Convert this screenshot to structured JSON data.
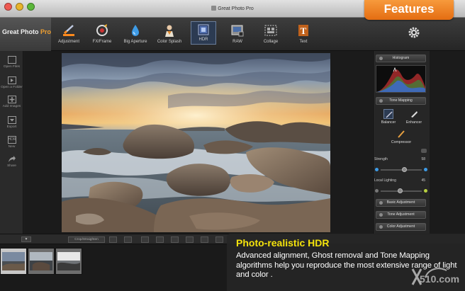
{
  "window": {
    "title": "Great Photo Pro"
  },
  "features_tab": "Features",
  "brand": {
    "name": "Great Photo",
    "suffix": "Pro"
  },
  "toolbar": {
    "tools": [
      {
        "label": "Adjustment",
        "icon": "adjustment-icon"
      },
      {
        "label": "FX/Frame",
        "icon": "fx-frame-icon"
      },
      {
        "label": "Big Aperture",
        "icon": "big-aperture-icon"
      },
      {
        "label": "Color Splash",
        "icon": "color-splash-icon"
      },
      {
        "label": "HDR",
        "icon": "hdr-icon",
        "active": true
      },
      {
        "label": "RAW",
        "icon": "raw-icon"
      },
      {
        "label": "Collage",
        "icon": "collage-icon"
      },
      {
        "label": "Text",
        "icon": "text-icon"
      }
    ],
    "settings_icon": "gear-icon"
  },
  "sidebar": {
    "items": [
      {
        "label": "Open Files",
        "icon": "open-files-icon"
      },
      {
        "label": "Open a Folder",
        "icon": "open-folder-icon"
      },
      {
        "label": "Add Images",
        "icon": "add-images-icon"
      },
      {
        "label": "Export",
        "icon": "export-icon"
      },
      {
        "label": "New",
        "icon": "hdr-new-icon",
        "glyph": "HDR"
      },
      {
        "label": "Share",
        "icon": "share-icon"
      }
    ]
  },
  "panel": {
    "histogram_label": "Histogram",
    "tone_mapping_label": "Tone Mapping",
    "modes": [
      {
        "label": "Balancer",
        "icon": "balancer-icon"
      },
      {
        "label": "Enhancer",
        "icon": "enhancer-icon"
      },
      {
        "label": "Compressor",
        "icon": "compressor-icon"
      }
    ],
    "strength_label": "Strength",
    "strength_value": "58",
    "local_lighting_label": "Local Lighting",
    "local_lighting_value": "45",
    "basic_adjustment_label": "Basic Adjustment",
    "tone_adjustment_label": "Tone Adjustment",
    "color_adjustment_label": "Color Adjustment"
  },
  "bottom": {
    "crop_label": "Crop/Straighten",
    "dropdown_glyph": "▼"
  },
  "overlay": {
    "title": "Photo-realistic HDR",
    "description": "Advanced alignment, Ghost removal and Tone Mapping algorithms help you reproduce the most extensive range of light and color ."
  },
  "watermark": "510.com",
  "colors": {
    "accent": "#f08424",
    "highlight_text": "#f4e30c",
    "active_tool": "#2c3b52"
  }
}
